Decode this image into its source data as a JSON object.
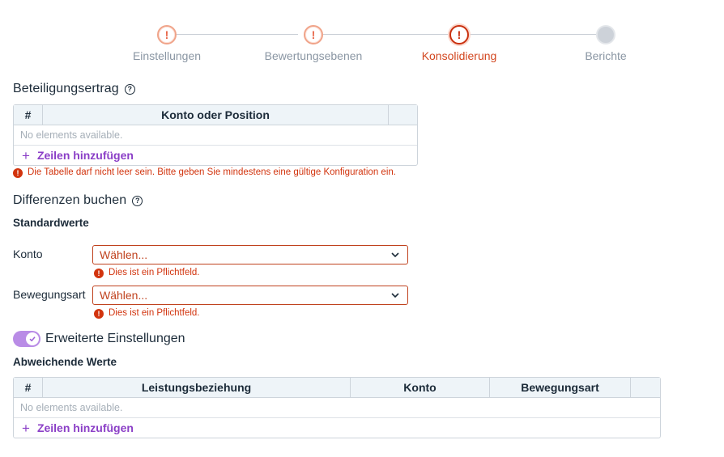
{
  "stepper": {
    "steps": [
      {
        "label": "Einstellungen",
        "state": "warning",
        "icon": "exclamation"
      },
      {
        "label": "Bewertungsebenen",
        "state": "warning",
        "icon": "exclamation"
      },
      {
        "label": "Konsolidierung",
        "state": "active-error",
        "icon": "exclamation"
      },
      {
        "label": "Berichte",
        "state": "todo",
        "icon": ""
      }
    ]
  },
  "beteiligung": {
    "title": "Beteiligungsertrag",
    "help_icon": "?",
    "table": {
      "headers": [
        "#",
        "Konto oder Position",
        ""
      ],
      "empty_text": "No elements available.",
      "add_label": "Zeilen hinzufügen",
      "add_icon": "+"
    },
    "error": "Die Tabelle darf nicht leer sein. Bitte geben Sie mindestens eine gültige Konfiguration ein.",
    "error_icon": "!"
  },
  "differenzen": {
    "title": "Differenzen buchen",
    "help_icon": "?",
    "subtitle": "Standardwerte",
    "konto": {
      "label": "Konto",
      "placeholder": "Wählen...",
      "error": "Dies ist ein Pflichtfeld.",
      "error_icon": "!"
    },
    "bewegungsart": {
      "label": "Bewegungsart",
      "placeholder": "Wählen...",
      "error": "Dies ist ein Pflichtfeld.",
      "error_icon": "!"
    }
  },
  "erweitert": {
    "toggle_label": "Erweiterte Einstellungen",
    "toggle_on": true,
    "subtitle": "Abweichende Werte",
    "table": {
      "headers": [
        "#",
        "Leistungsbeziehung",
        "Konto",
        "Bewegungsart",
        ""
      ],
      "empty_text": "No elements available.",
      "add_label": "Zeilen hinzufügen",
      "add_icon": "+"
    }
  },
  "colors": {
    "accent_purple": "#8b3fc7",
    "error_red": "#d2340e",
    "active_step": "#d2461f"
  }
}
